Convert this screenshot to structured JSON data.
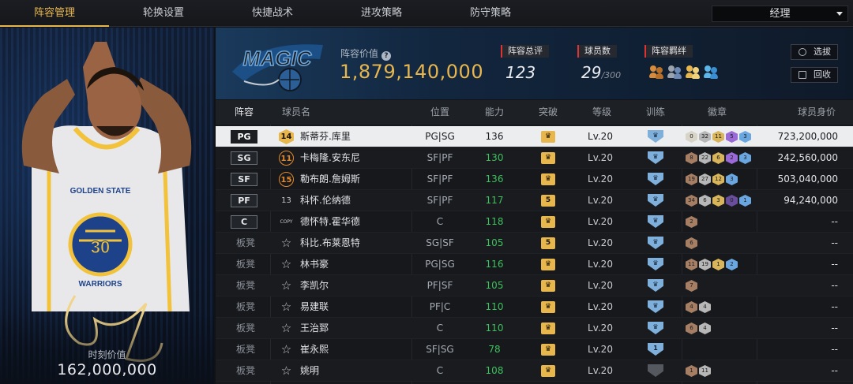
{
  "nav": {
    "tabs": [
      "阵容管理",
      "轮换设置",
      "快捷战术",
      "进攻策略",
      "防守策略"
    ],
    "active_index": 0,
    "role_select": "经理"
  },
  "player_card": {
    "jersey_number": "30",
    "jersey_text": "GOLDEN STATE",
    "jersey_text2": "WARRIORS",
    "moment_label": "时刻价值",
    "moment_value": "162,000,000"
  },
  "team_header": {
    "logo_text": "MAGIC",
    "value_label": "阵容价值",
    "value_amount": "1,879,140,000",
    "overall_label": "阵容总评",
    "overall_value": "123",
    "count_label": "球员数",
    "count_value": "29",
    "count_max": "/300",
    "bond_label": "阵容羁绊",
    "bond_icons": [
      "bond-icon-orange",
      "bond-icon-gray",
      "bond-icon-gold",
      "bond-icon-blue"
    ],
    "select_button": "选拔",
    "recycle_button": "回收"
  },
  "table": {
    "headers": {
      "lineup": "阵容",
      "name": "球员名",
      "position": "位置",
      "ability": "能力",
      "breakthrough": "突破",
      "level": "等级",
      "training": "训练",
      "badges": "徽章",
      "value": "球员身价"
    },
    "rows": [
      {
        "slot": "PG",
        "bench": false,
        "jersey": "14",
        "jersey_style": "gold",
        "name": "斯蒂芬.库里",
        "position": "PG|SG",
        "ability": "136",
        "break": "♛",
        "level": "Lv.20",
        "train": "♛",
        "train_gray": false,
        "badges": [
          {
            "t": "0",
            "c": "#d9d4c8"
          },
          {
            "t": "32",
            "c": "#b7b7b7"
          },
          {
            "t": "11",
            "c": "#d8b45a"
          },
          {
            "t": "5",
            "c": "#9a6ad6"
          },
          {
            "t": "3",
            "c": "#6aa7e0"
          }
        ],
        "value": "723,200,000"
      },
      {
        "slot": "SG",
        "bench": false,
        "jersey": "11",
        "jersey_style": "orange",
        "name": "卡梅隆.安东尼",
        "position": "SF|PF",
        "ability": "130",
        "break": "♛",
        "level": "Lv.20",
        "train": "♛",
        "train_gray": false,
        "badges": [
          {
            "t": "8",
            "c": "#a57e64"
          },
          {
            "t": "22",
            "c": "#b7b7b7"
          },
          {
            "t": "6",
            "c": "#d8b45a"
          },
          {
            "t": "2",
            "c": "#9a6ad6"
          },
          {
            "t": "3",
            "c": "#6aa7e0"
          }
        ],
        "value": "242,560,000"
      },
      {
        "slot": "SF",
        "bench": false,
        "jersey": "15",
        "jersey_style": "orange",
        "name": "勒布朗.詹姆斯",
        "position": "SF|PF",
        "ability": "136",
        "break": "♛",
        "level": "Lv.20",
        "train": "♛",
        "train_gray": false,
        "badges": [
          {
            "t": "19",
            "c": "#a57e64"
          },
          {
            "t": "27",
            "c": "#b7b7b7"
          },
          {
            "t": "12",
            "c": "#d8b45a"
          },
          {
            "t": "3",
            "c": "#6aa7e0"
          }
        ],
        "value": "503,040,000"
      },
      {
        "slot": "PF",
        "bench": false,
        "jersey": "13",
        "jersey_style": "plain",
        "name": "科怀.伦纳德",
        "position": "SF|PF",
        "ability": "117",
        "break": "5",
        "level": "Lv.20",
        "train": "♛",
        "train_gray": false,
        "badges": [
          {
            "t": "34",
            "c": "#a57e64"
          },
          {
            "t": "6",
            "c": "#b7b7b7"
          },
          {
            "t": "3",
            "c": "#d8b45a"
          },
          {
            "t": "0",
            "c": "#6a4e9e"
          },
          {
            "t": "1",
            "c": "#6aa7e0"
          }
        ],
        "value": "94,240,000"
      },
      {
        "slot": "C",
        "bench": false,
        "jersey": "COPY",
        "jersey_style": "tiny",
        "name": "德怀特.霍华德",
        "position": "C",
        "ability": "118",
        "break": "♛",
        "level": "Lv.20",
        "train": "♛",
        "train_gray": false,
        "badges": [
          {
            "t": "2",
            "c": "#a57e64"
          }
        ],
        "value": "--"
      },
      {
        "slot": "板凳",
        "bench": true,
        "jersey": "☆",
        "jersey_style": "star",
        "name": "科比.布莱恩特",
        "position": "SG|SF",
        "ability": "105",
        "break": "5",
        "level": "Lv.20",
        "train": "♛",
        "train_gray": false,
        "badges": [
          {
            "t": "6",
            "c": "#a57e64"
          }
        ],
        "value": "--"
      },
      {
        "slot": "板凳",
        "bench": true,
        "jersey": "☆",
        "jersey_style": "star",
        "name": "林书豪",
        "position": "PG|SG",
        "ability": "116",
        "break": "♛",
        "level": "Lv.20",
        "train": "♛",
        "train_gray": false,
        "badges": [
          {
            "t": "11",
            "c": "#a57e64"
          },
          {
            "t": "19",
            "c": "#b7b7b7"
          },
          {
            "t": "1",
            "c": "#d8b45a"
          },
          {
            "t": "2",
            "c": "#6aa7e0"
          }
        ],
        "value": "--"
      },
      {
        "slot": "板凳",
        "bench": true,
        "jersey": "☆",
        "jersey_style": "star",
        "name": "李凯尔",
        "position": "PF|SF",
        "ability": "105",
        "break": "♛",
        "level": "Lv.20",
        "train": "♛",
        "train_gray": false,
        "badges": [
          {
            "t": "7",
            "c": "#a57e64"
          }
        ],
        "value": "--"
      },
      {
        "slot": "板凳",
        "bench": true,
        "jersey": "☆",
        "jersey_style": "star",
        "name": "易建联",
        "position": "PF|C",
        "ability": "110",
        "break": "♛",
        "level": "Lv.20",
        "train": "♛",
        "train_gray": false,
        "badges": [
          {
            "t": "4",
            "c": "#a57e64"
          },
          {
            "t": "4",
            "c": "#b7b7b7"
          }
        ],
        "value": "--"
      },
      {
        "slot": "板凳",
        "bench": true,
        "jersey": "☆",
        "jersey_style": "star",
        "name": "王治郅",
        "position": "C",
        "ability": "110",
        "break": "♛",
        "level": "Lv.20",
        "train": "♛",
        "train_gray": false,
        "badges": [
          {
            "t": "6",
            "c": "#a57e64"
          },
          {
            "t": "4",
            "c": "#b7b7b7"
          }
        ],
        "value": "--"
      },
      {
        "slot": "板凳",
        "bench": true,
        "jersey": "☆",
        "jersey_style": "star",
        "name": "崔永熙",
        "position": "SF|SG",
        "ability": "78",
        "break": "♛",
        "level": "Lv.20",
        "train": "1",
        "train_gray": false,
        "badges": [],
        "value": "--"
      },
      {
        "slot": "板凳",
        "bench": true,
        "jersey": "☆",
        "jersey_style": "star",
        "name": "姚明",
        "position": "C",
        "ability": "108",
        "break": "♛",
        "level": "Lv.20",
        "train": "",
        "train_gray": true,
        "badges": [
          {
            "t": "1",
            "c": "#a57e64"
          },
          {
            "t": "11",
            "c": "#b7b7b7"
          }
        ],
        "value": "--"
      }
    ]
  },
  "colors": {
    "accent_gold": "#e7b64c",
    "ability_green": "#3cc25c",
    "train_blue": "#7fb0db"
  }
}
